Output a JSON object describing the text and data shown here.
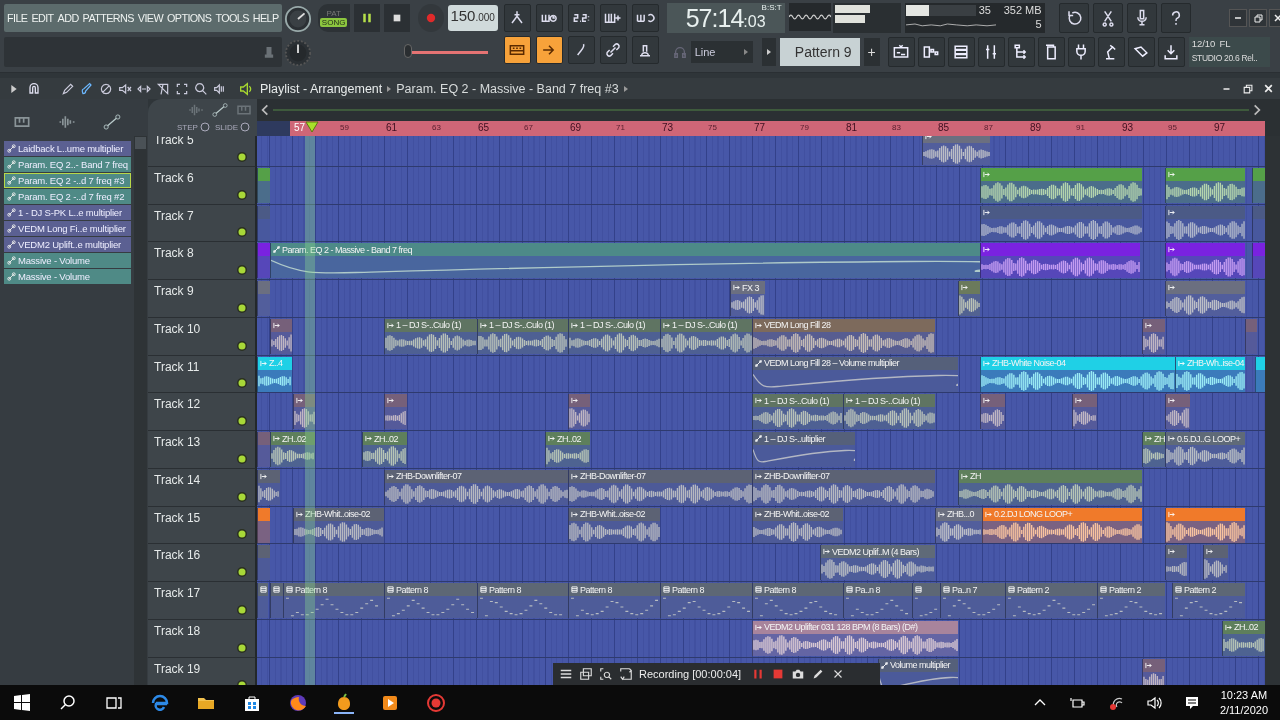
{
  "menu": [
    "FILE",
    "EDIT",
    "ADD",
    "PATTERNS",
    "VIEW",
    "OPTIONS",
    "TOOLS",
    "HELP"
  ],
  "transport": {
    "pat": "PAT",
    "song": "SONG",
    "song_mode": true,
    "tempo": "150",
    "tempo_frac": ".000",
    "time_main": "57:14",
    "time_ticks": ":03",
    "time_unit": "B:S:T"
  },
  "main_slider": {
    "level": 0.05
  },
  "monitor": {
    "peak_left": {
      "level": 0.55
    },
    "peak_right": {
      "level": 0.47
    },
    "cpu": {
      "level": 0.34
    },
    "polyphony": "35",
    "memory": "352 MB",
    "voices": "5"
  },
  "snap": "Line",
  "pattern": "Pattern 9",
  "add": "+",
  "news": {
    "date": "12/10",
    "brand": "FL",
    "line2": "STUDIO 20.6 Rel.."
  },
  "playlist": {
    "title": "Playlist - Arrangement",
    "breadcrumb": "Param. EQ 2 - Massive - Band 7 freq #3",
    "step": "STEP",
    "slide": "SLIDE"
  },
  "clip_list": [
    {
      "label": "Laidback L..ume multiplier",
      "color": "#5b6092",
      "selected": false
    },
    {
      "label": "Param. EQ 2..- Band 7 freq",
      "color": "#4f8a86",
      "selected": false
    },
    {
      "label": "Param. EQ 2 -..d 7 freq #3",
      "color": "#4f8a86",
      "selected": true
    },
    {
      "label": "Param. EQ 2 -..d 7 freq #2",
      "color": "#4f8a86",
      "selected": false
    },
    {
      "label": "1 - DJ S-PK L..e multiplier",
      "color": "#5b6092",
      "selected": false
    },
    {
      "label": "VEDM Long Fi..e multiplier",
      "color": "#5b6092",
      "selected": false
    },
    {
      "label": "VEDM2 Uplift..e multiplier",
      "color": "#5b6092",
      "selected": false
    },
    {
      "label": "Massive - Volume",
      "color": "#4f8a86",
      "selected": false
    },
    {
      "label": "Massive - Volume",
      "color": "#4f8a86",
      "selected": false
    }
  ],
  "ruler": [
    "57",
    "59",
    "61",
    "63",
    "65",
    "67",
    "69",
    "71",
    "73",
    "75",
    "77",
    "79",
    "81",
    "83",
    "85",
    "87",
    "89",
    "91",
    "93",
    "95",
    "97"
  ],
  "tracks": [
    {
      "name": "Track 5",
      "clips": [
        {
          "kind": "audio",
          "color": "#6b6f80"
        }
      ]
    },
    {
      "name": "Track 6",
      "clips": [
        {
          "kind": "audio",
          "color": "#55a048"
        },
        {
          "kind": "audio",
          "color": "#55a048"
        },
        {
          "kind": "audio",
          "color": "#55a048"
        },
        {
          "kind": "audio",
          "color": "#55a048"
        }
      ]
    },
    {
      "name": "Track 7",
      "clips": [
        {
          "kind": "audio",
          "color": "#4b5a86"
        },
        {
          "kind": "audio",
          "color": "#4b5a86"
        },
        {
          "kind": "audio",
          "color": "#4b5a86"
        },
        {
          "kind": "audio",
          "color": "#4b5a86"
        }
      ]
    },
    {
      "name": "Track 8",
      "clips": [
        {
          "kind": "audio",
          "color": "#7a22e0"
        },
        {
          "kind": "automation",
          "color": "#4d8a88",
          "label": "Param. EQ 2 - Massive - Band 7 freq"
        },
        {
          "kind": "audio",
          "color": "#7a22e0"
        },
        {
          "kind": "audio",
          "color": "#7a22e0"
        },
        {
          "kind": "audio",
          "color": "#7a22e0"
        }
      ]
    },
    {
      "name": "Track 9",
      "clips": [
        {
          "kind": "audio",
          "color": "#6b6f80"
        },
        {
          "kind": "audio",
          "color": "#6b6f80",
          "label": "FX 3"
        },
        {
          "kind": "audio",
          "color": "#6b7a5c"
        },
        {
          "kind": "audio",
          "color": "#6b6f80"
        }
      ]
    },
    {
      "name": "Track 10",
      "clips": [
        {
          "kind": "audio",
          "color": "#76607a"
        },
        {
          "kind": "audio",
          "color": "#5f7462",
          "label": "1 – DJ S-..Culo (1)"
        },
        {
          "kind": "audio",
          "color": "#5f7462",
          "label": "1 – DJ S-..Culo (1)"
        },
        {
          "kind": "audio",
          "color": "#5f7462",
          "label": "1 – DJ S-..Culo (1)"
        },
        {
          "kind": "audio",
          "color": "#5f7462",
          "label": "1 – DJ S-..Culo (1)"
        },
        {
          "kind": "audio",
          "color": "#7d6a5c",
          "label": "VEDM Long Fill 28"
        },
        {
          "kind": "audio",
          "color": "#76607a"
        },
        {
          "kind": "audio",
          "color": "#76607a"
        }
      ]
    },
    {
      "name": "Track 11",
      "clips": [
        {
          "kind": "audio",
          "color": "#1fd0e6",
          "label": "Z..4"
        },
        {
          "kind": "automation",
          "color": "#55607a",
          "label": "VEDM Long Fill 28 – Volume multiplier"
        },
        {
          "kind": "audio",
          "color": "#1fd0e6",
          "label": "ZHB-White Noise-04"
        },
        {
          "kind": "audio",
          "color": "#1fd0e6",
          "label": "ZHB-Wh..ise-04"
        },
        {
          "kind": "audio",
          "color": "#1fd0e6"
        }
      ]
    },
    {
      "name": "Track 12",
      "clips": [
        {
          "kind": "audio",
          "color": "#76607a"
        },
        {
          "kind": "audio",
          "color": "#76607a"
        },
        {
          "kind": "audio",
          "color": "#76607a"
        },
        {
          "kind": "audio",
          "color": "#5f7462",
          "label": "1 – DJ S-..Culo (1)"
        },
        {
          "kind": "audio",
          "color": "#5f7462",
          "label": "1 – DJ S-..Culo (1)"
        },
        {
          "kind": "audio",
          "color": "#76607a"
        },
        {
          "kind": "audio",
          "color": "#76607a"
        },
        {
          "kind": "audio",
          "color": "#76607a"
        }
      ]
    },
    {
      "name": "Track 13",
      "clips": [
        {
          "kind": "audio",
          "color": "#76607a"
        },
        {
          "kind": "audio",
          "color": "#5e7f5c",
          "label": "ZH..02"
        },
        {
          "kind": "audio",
          "color": "#5e7f5c",
          "label": "ZH..02"
        },
        {
          "kind": "audio",
          "color": "#5e7f5c",
          "label": "ZH..02"
        },
        {
          "kind": "automation",
          "color": "#55607a",
          "label": "1 – DJ S-..ultiplier"
        },
        {
          "kind": "audio",
          "color": "#5e7f5c",
          "label": "ZH"
        },
        {
          "kind": "audio",
          "color": "#5f6a78",
          "label": "0.5.DJ..G LOOP+"
        }
      ]
    },
    {
      "name": "Track 14",
      "clips": [
        {
          "kind": "audio",
          "color": "#5c6274"
        },
        {
          "kind": "audio",
          "color": "#5c6274",
          "label": "ZHB-Downlifter-07"
        },
        {
          "kind": "audio",
          "color": "#5c6274",
          "label": "ZHB-Downlifter-07"
        },
        {
          "kind": "audio",
          "color": "#5c6274",
          "label": "ZHB-Downlifter-07"
        },
        {
          "kind": "audio",
          "color": "#5e7f5c",
          "label": "ZH"
        }
      ]
    },
    {
      "name": "Track 15",
      "clips": [
        {
          "kind": "audio",
          "color": "#f07a2a"
        },
        {
          "kind": "audio",
          "color": "#5c6274",
          "label": "ZHB-Whit..oise-02"
        },
        {
          "kind": "audio",
          "color": "#5c6274",
          "label": "ZHB-Whit..oise-02"
        },
        {
          "kind": "audio",
          "color": "#5c6274",
          "label": "ZHB-Whit..oise-02"
        },
        {
          "kind": "audio",
          "color": "#6b6f80",
          "label": "ZHB...0"
        },
        {
          "kind": "audio",
          "color": "#f07a2a",
          "label": "0.2.DJ LONG LOOP+"
        },
        {
          "kind": "audio",
          "color": "#f07a2a"
        }
      ]
    },
    {
      "name": "Track 16",
      "clips": [
        {
          "kind": "audio",
          "color": "#5c6274"
        },
        {
          "kind": "audio",
          "color": "#5f6a78",
          "label": "VEDM2 Uplif..M (4 Bars)"
        },
        {
          "kind": "audio",
          "color": "#5c6274"
        },
        {
          "kind": "audio",
          "color": "#5c6274"
        }
      ]
    },
    {
      "name": "Track 17",
      "clips": [
        {
          "kind": "pattern",
          "color": "#5d6775"
        },
        {
          "kind": "pattern",
          "color": "#5d6775"
        },
        {
          "kind": "pattern",
          "color": "#5d6775",
          "label": "Pattern 8"
        },
        {
          "kind": "pattern",
          "color": "#5d6775",
          "label": "Pattern 8"
        },
        {
          "kind": "pattern",
          "color": "#5d6775",
          "label": "Pattern 8"
        },
        {
          "kind": "pattern",
          "color": "#5d6775",
          "label": "Pattern 8"
        },
        {
          "kind": "pattern",
          "color": "#5d6775",
          "label": "Pattern 8"
        },
        {
          "kind": "pattern",
          "color": "#5d6775",
          "label": "Pattern 8"
        },
        {
          "kind": "pattern",
          "color": "#5d6775",
          "label": "Pa..n 8"
        },
        {
          "kind": "pattern",
          "color": "#5d6775"
        },
        {
          "kind": "pattern",
          "color": "#5d6775",
          "label": "Pa..n 7"
        },
        {
          "kind": "pattern",
          "color": "#5d6775",
          "label": "Pattern 2"
        },
        {
          "kind": "pattern",
          "color": "#5d6775",
          "label": "Pattern 2"
        },
        {
          "kind": "pattern",
          "color": "#5d6775",
          "label": "Pattern 2"
        }
      ]
    },
    {
      "name": "Track 18",
      "clips": [
        {
          "kind": "audio",
          "color": "#a8849c",
          "label": "VEDM2 Uplifter 031 128 BPM (8 Bars) (D#)"
        },
        {
          "kind": "audio",
          "color": "#5e7f5c",
          "label": "ZH..02"
        }
      ]
    },
    {
      "name": "Track 19",
      "clips": [
        {
          "kind": "automation",
          "color": "#55607a",
          "label": "Volume multiplier"
        },
        {
          "kind": "audio",
          "color": "#76607a"
        }
      ]
    }
  ],
  "recorder": {
    "text": "Recording [00:00:04]"
  },
  "taskbar": {
    "time": "10:23 AM",
    "date": "2/11/2020"
  }
}
